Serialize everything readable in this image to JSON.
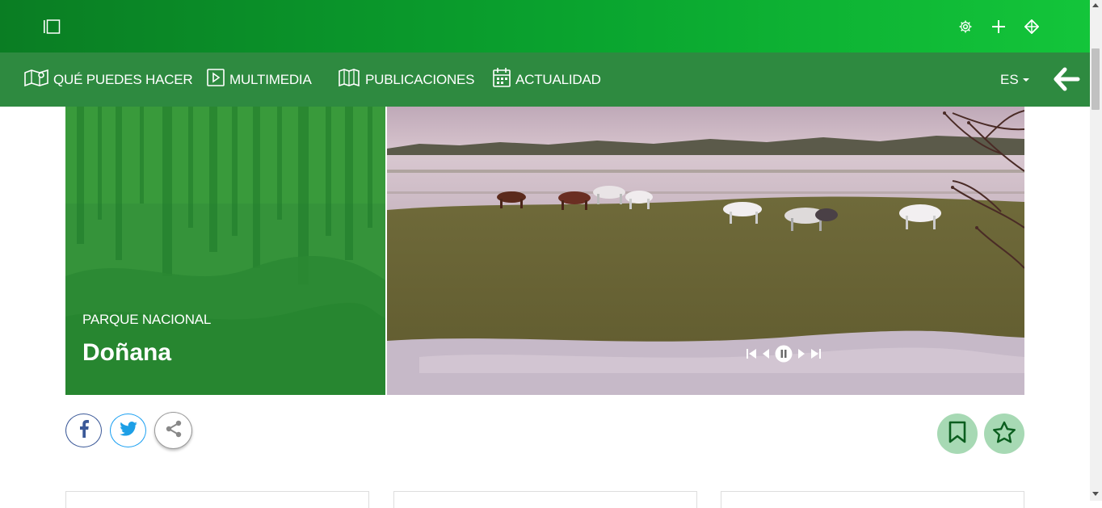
{
  "nav": {
    "items": [
      {
        "label": "QUÉ PUEDES HACER",
        "icon": "map-pin-icon"
      },
      {
        "label": "MULTIMEDIA",
        "icon": "play-icon"
      },
      {
        "label": "PUBLICACIONES",
        "icon": "book-icon"
      },
      {
        "label": "ACTUALIDAD",
        "icon": "calendar-icon"
      }
    ],
    "language": "ES"
  },
  "hero": {
    "kicker": "PARQUE NACIONAL",
    "title": "Doñana"
  },
  "colors": {
    "topbar": "#0a9a2c",
    "navbar": "#2e8a40",
    "accent_soft": "#a7d9b4",
    "facebook": "#3b5998",
    "twitter": "#1da1f2"
  }
}
